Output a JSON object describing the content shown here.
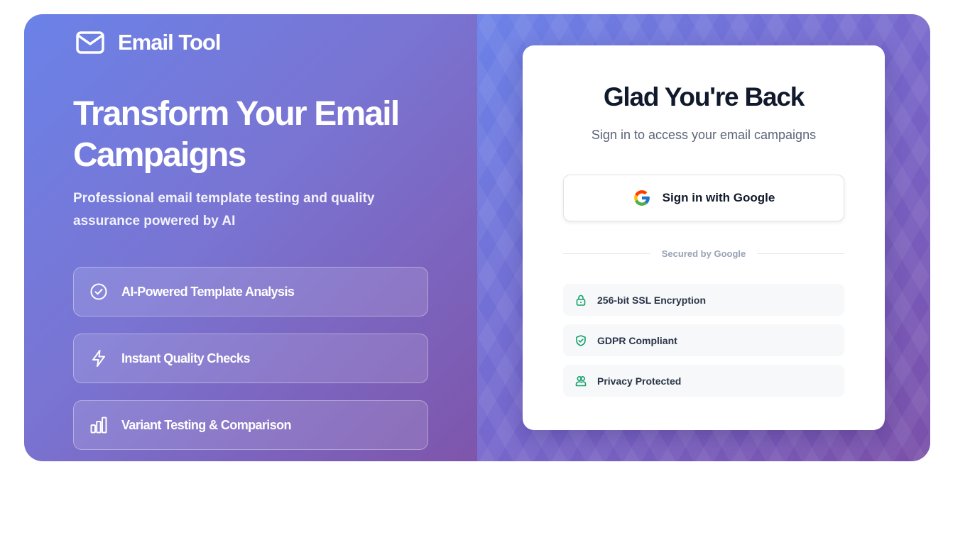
{
  "brand": {
    "name": "Email Tool",
    "icon": "envelope-icon"
  },
  "hero": {
    "title": "Transform Your Email Campaigns",
    "subtitle": "Professional email template testing and quality assurance powered by AI"
  },
  "features": [
    {
      "label": "AI-Powered Template Analysis",
      "icon": "check-circle-icon"
    },
    {
      "label": "Instant Quality Checks",
      "icon": "lightning-icon"
    },
    {
      "label": "Variant Testing & Comparison",
      "icon": "bar-chart-icon"
    }
  ],
  "login": {
    "title": "Glad You're Back",
    "subtitle": "Sign in to access your email campaigns",
    "google_button": "Sign in with Google",
    "divider": "Secured by Google"
  },
  "badges": [
    {
      "label": "256-bit SSL Encryption",
      "icon": "lock-icon"
    },
    {
      "label": "GDPR Compliant",
      "icon": "shield-check-icon"
    },
    {
      "label": "Privacy Protected",
      "icon": "users-icon"
    }
  ],
  "colors": {
    "gradient_start": "#6b82e8",
    "gradient_end": "#7e55ab",
    "badge_icon": "#16a06a",
    "title_text": "#111a2c"
  }
}
